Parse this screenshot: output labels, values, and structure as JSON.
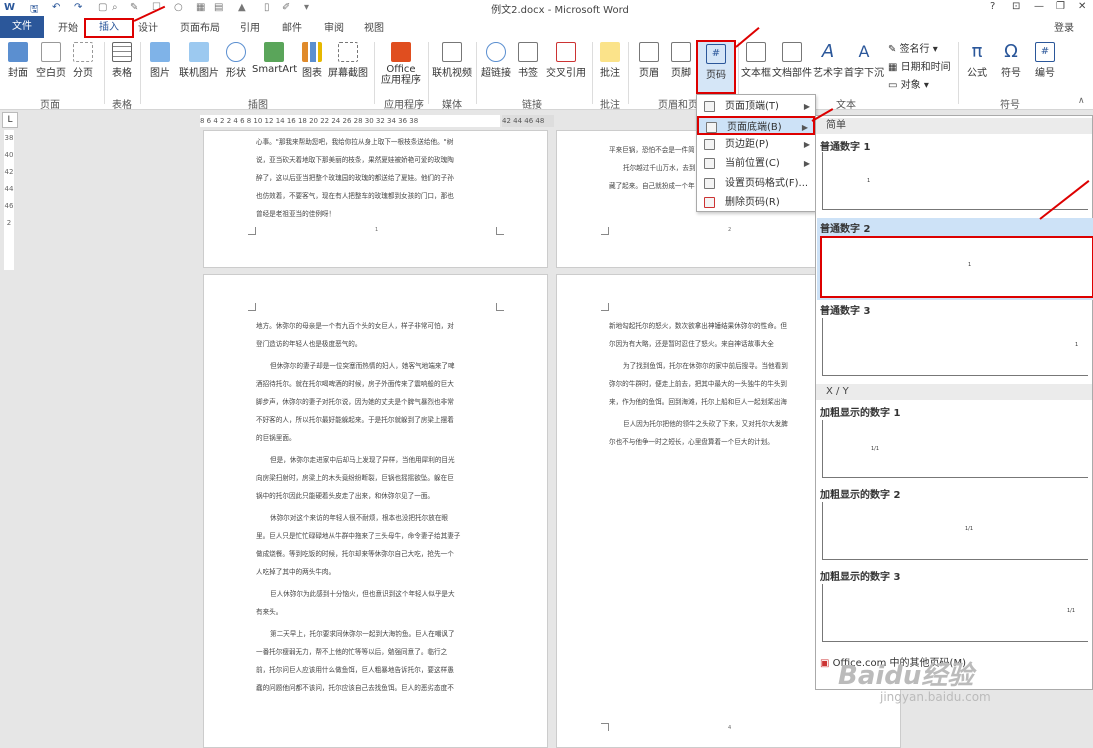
{
  "window": {
    "title": "例文2.docx - Microsoft Word",
    "controls": [
      "?",
      "⊡",
      "—",
      "❐",
      "✕"
    ],
    "login": "登录"
  },
  "tabs": [
    "文件",
    "开始",
    "插入",
    "设计",
    "页面布局",
    "引用",
    "邮件",
    "审阅",
    "视图"
  ],
  "ribbon": {
    "pages": [
      "封面",
      "空白页",
      "分页"
    ],
    "pages_group": "页面",
    "table": "表格",
    "table_group": "表格",
    "illust": [
      "图片",
      "联机图片",
      "形状",
      "SmartArt",
      "图表",
      "屏幕截图"
    ],
    "illust_group": "插图",
    "apps": "Office\n应用程序",
    "apps_group": "应用程序",
    "media": "联机视频",
    "media_group": "媒体",
    "links": [
      "超链接",
      "书签",
      "交叉引用"
    ],
    "links_group": "链接",
    "comment": "批注",
    "comment_group": "批注",
    "hf": [
      "页眉",
      "页脚",
      "页码"
    ],
    "hf_group": "页眉和页",
    "text": [
      "文本框",
      "文档部件",
      "艺术字",
      "首字下沉"
    ],
    "text_group": "文本",
    "text_small": [
      "签名行",
      "日期和时间",
      "对象"
    ],
    "symbols": [
      "公式",
      "符号",
      "编号"
    ],
    "symbols_group": "符号"
  },
  "ruler": {
    "box": "L",
    "left_scale": "8  6  4  2    2  4  6  8  10  12  14  16  18  20  22  24  26  28  30  32  34  36  38",
    "right_scale": "42  44  46  48",
    "vertical": "38 40 42 44 46 2"
  },
  "menu": {
    "items": [
      {
        "label": "页面顶端(T)"
      },
      {
        "label": "页面底端(B)"
      },
      {
        "label": "页边距(P)"
      },
      {
        "label": "当前位置(C)"
      },
      {
        "label": "设置页码格式(F)..."
      },
      {
        "label": "删除页码(R)"
      }
    ]
  },
  "gallery": {
    "section_simple": "简单",
    "items": [
      {
        "label": "普通数字 1",
        "num": "1"
      },
      {
        "label": "普通数字 2",
        "num": "1"
      },
      {
        "label": "普通数字 3",
        "num": "1"
      }
    ],
    "section_xy": "X / Y",
    "bold_items": [
      {
        "label": "加粗显示的数字 1",
        "num": "1/1"
      },
      {
        "label": "加粗显示的数字 2",
        "num": "1/1"
      },
      {
        "label": "加粗显示的数字 3",
        "num": "1/1"
      }
    ],
    "footer": "Office.com 中的其他页码(M)"
  },
  "pages": {
    "p1": [
      "心事。\"那我来帮助您吧，我给你拉从身上取下一根枝条送给他。\"树",
      "说，亚当砍天着地取下那美丽的枝条，果然夏娃被娇艳可爱的玫瑰陶",
      "醉了，这以后亚当把整个玫瑰园的玫瑰的都送给了夏娃。他们的子孙",
      "也仿效着，不要客气，现在有人把整车的玫瑰都到女孩的门口，那也",
      "曾经是老祖亚当的佳例呀！"
    ],
    "p2": [
      "平来巨锅，恐怕不会是一件简",
      "托尔越过千山万水，去到",
      "藏了起来。自己就扮成一个年"
    ],
    "p3": [
      "地方。休弥尔的母亲是一个有九百个头的女巨人，样子非常可怕，对",
      "登门造访的年轻人也是极度恶气的。",
      "但休弥尔的妻子却是一位突塞而热情的妇人，她客气地端来了啤",
      "酒招待托尔。就在托尔喝啤酒的时候，房子外面传来了震响般的巨大",
      "脚步声，休弥尔的妻子对托尔说，因为她的丈夫是个脾气暴烈也非常",
      "不好客的人，所以托尔最好能躲起来。于是托尔就躲到了房梁上摆着",
      "的巨锅里面。",
      "但是，休弥尔走进家中后却马上发现了异样，当他用犀利的目光",
      "向房梁扫射时，房梁上的木头竟纷纷断裂，巨锅也摇摇欲坠。躲在巨",
      "锅中的托尔因此只能硬着头皮走了出来，和休弥尔见了一面。",
      "休弥尔对这个来访的年轻人很不耐烦，根本也没把托尔放在眼",
      "里。巨人只是忙忙碌碌地从牛群中拖来了三头母牛，命令妻子给其妻子",
      "做成烧餐。等到吃饭的时候，托尔却来等休弥尔自己大吃，抢先一个",
      "人吃掉了其中的两头牛肉。",
      "巨人休弥尔为此感到十分恼火，但也意识到这个年轻人似乎是大",
      "有来头。",
      "第二天早上，托尔要求同休弥尔一起到大海钓鱼。巨人在嘲讽了",
      "一番托尔瘦弱无力，帮不上他的忙等等以后，勉强同意了。临行之",
      "前，托尔问巨人应该用什么做鱼饵，巨人粗暴地告诉托尔，要这样愚",
      "蠢的问题他问都不该问，托尔应该自己去找鱼饵。巨人的恶劣态度不"
    ],
    "p4": [
      "新地勾起托尔的怒火，数次欲拿出神锤结果休弥尔的性命。但",
      "尔因为有大略，还是暂时忍住了怒火。来自神话故事大全",
      "为了找到鱼饵，托尔在休弥尔的家中前后搜寻。当他看到",
      "弥尔的牛群时，便走上前去，把其中最大的一头独牛的牛头到",
      "来，作为他的鱼饵。回到海滩，托尔上船和巨人一起划桨出海",
      "巨人因为托尔把他的领牛之头砍了下来，又对托尔大发脾",
      "尔也不与他争一时之短长，心里盘算着一个巨大的计划。"
    ]
  },
  "watermark": {
    "brand": "Baidu经验",
    "url": "jingyan.baidu.com"
  }
}
